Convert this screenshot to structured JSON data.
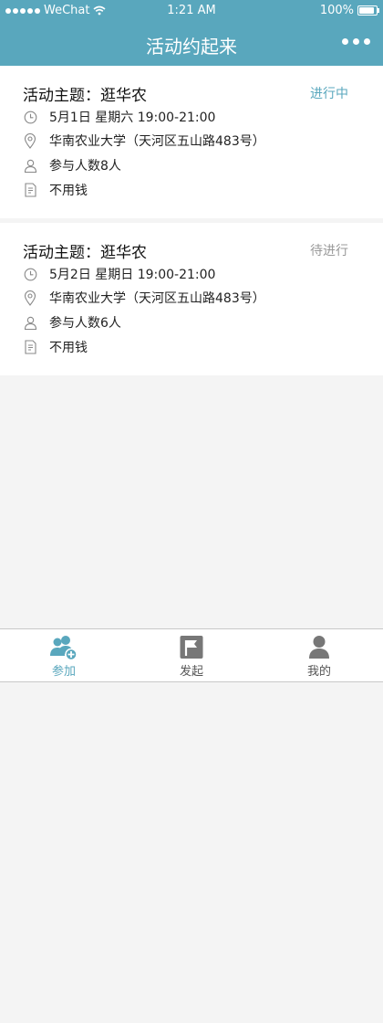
{
  "status_bar": {
    "carrier": "WeChat",
    "time": "1:21 AM",
    "battery": "100%"
  },
  "nav": {
    "title": "活动约起来",
    "more_icon": "more-dots-icon"
  },
  "colors": {
    "accent": "#59a7bd",
    "status_active": "#59a7bd",
    "status_pending": "#999999"
  },
  "activities": [
    {
      "title": "活动主题：逛华农",
      "status": "进行中",
      "datetime": "5月1日 星期六 19:00-21:00",
      "location": "华南农业大学（天河区五山路483号）",
      "participants": "参与人数8人",
      "cost": "不用钱"
    },
    {
      "title": "活动主题：逛华农",
      "status": "待进行",
      "datetime": "5月2日 星期日 19:00-21:00",
      "location": "华南农业大学（天河区五山路483号）",
      "participants": "参与人数6人",
      "cost": "不用钱"
    }
  ],
  "tabbar": {
    "items": [
      {
        "label": "参加",
        "icon": "join-users-icon",
        "active": true
      },
      {
        "label": "发起",
        "icon": "flag-icon",
        "active": false
      },
      {
        "label": "我的",
        "icon": "profile-icon",
        "active": false
      }
    ]
  }
}
